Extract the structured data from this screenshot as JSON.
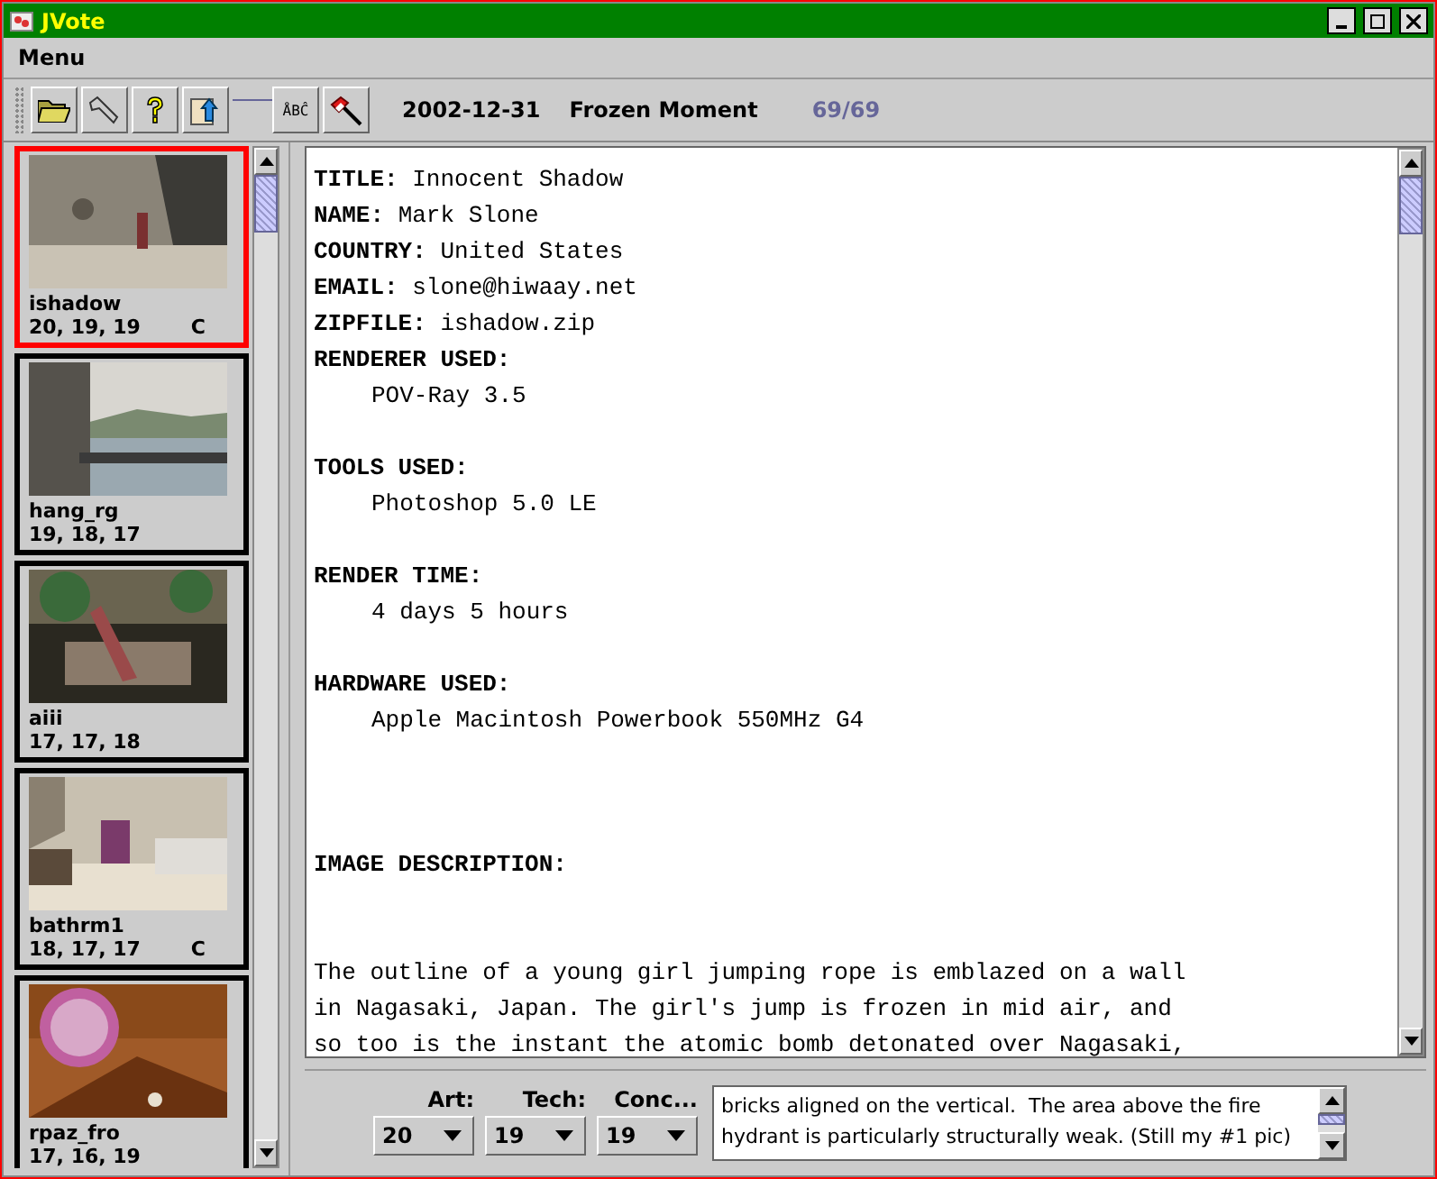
{
  "window": {
    "title": "JVote"
  },
  "menu": [
    "Menu"
  ],
  "toolbar": {
    "groups": [
      [
        {
          "kind": "open"
        },
        {
          "kind": "settings"
        },
        {
          "kind": "help"
        },
        {
          "kind": "upload"
        }
      ],
      [
        {
          "kind": "spell",
          "label": "ÅBĈ"
        },
        {
          "kind": "flag"
        }
      ]
    ],
    "date": "2002-12-31",
    "theme": "Frozen Moment",
    "count": "69/69"
  },
  "entries": [
    {
      "name": "ishadow",
      "scores": "20, 19, 19",
      "mark": "C",
      "selected": true
    },
    {
      "name": "hang_rg",
      "scores": "19, 18, 17",
      "selected": false
    },
    {
      "name": "aiii",
      "scores": "17, 17, 18",
      "selected": false
    },
    {
      "name": "bathrm1",
      "scores": "18, 17, 17",
      "mark": "C",
      "selected": false
    },
    {
      "name": "rpaz_fro",
      "scores": "17, 16, 19",
      "selected": false
    }
  ],
  "document": [
    {
      "kind": "field",
      "text": "**TITLE:** Innocent Shadow"
    },
    {
      "kind": "field",
      "text": "**NAME:** Mark Slone"
    },
    {
      "kind": "field",
      "text": "**COUNTRY:** United States"
    },
    {
      "kind": "field",
      "text": "**EMAIL:** slone@hiwaay.net"
    },
    {
      "kind": "field",
      "text": "**ZIPFILE:** ishadow.zip"
    },
    {
      "kind": "heading",
      "text": "RENDERER USED:"
    },
    {
      "kind": "value",
      "text": "POV-Ray 3.5"
    },
    {
      "kind": "blank"
    },
    {
      "kind": "heading",
      "text": "TOOLS USED:"
    },
    {
      "kind": "value",
      "text": "Photoshop 5.0 LE"
    },
    {
      "kind": "blank"
    },
    {
      "kind": "heading",
      "text": "RENDER TIME:"
    },
    {
      "kind": "value",
      "text": "4 days 5 hours"
    },
    {
      "kind": "blank"
    },
    {
      "kind": "heading",
      "text": "HARDWARE USED:"
    },
    {
      "kind": "value",
      "text": "Apple Macintosh Powerbook 550MHz G4"
    },
    {
      "kind": "blank"
    },
    {
      "kind": "blank"
    },
    {
      "kind": "blank"
    },
    {
      "kind": "heading",
      "text": "IMAGE DESCRIPTION:"
    },
    {
      "kind": "blank"
    },
    {
      "kind": "blank"
    },
    {
      "kind": "para",
      "text": "The outline of a young girl jumping rope is emblazed on a wall"
    },
    {
      "kind": "para",
      "text": "in Nagasaki, Japan. The girl's jump is frozen in mid air, and"
    },
    {
      "kind": "para",
      "text": "so too is the instant the atomic bomb detonated over Nagasaki,"
    }
  ],
  "ratings": [
    {
      "label": "Art:",
      "value": "20"
    },
    {
      "label": "Tech:",
      "value": "19"
    },
    {
      "label": "Conc...",
      "value": "19"
    }
  ],
  "comment": [
    "bricks aligned on the vertical.  The area above the fire",
    "hydrant is particularly structurally weak. (Still my #1 pic)"
  ]
}
